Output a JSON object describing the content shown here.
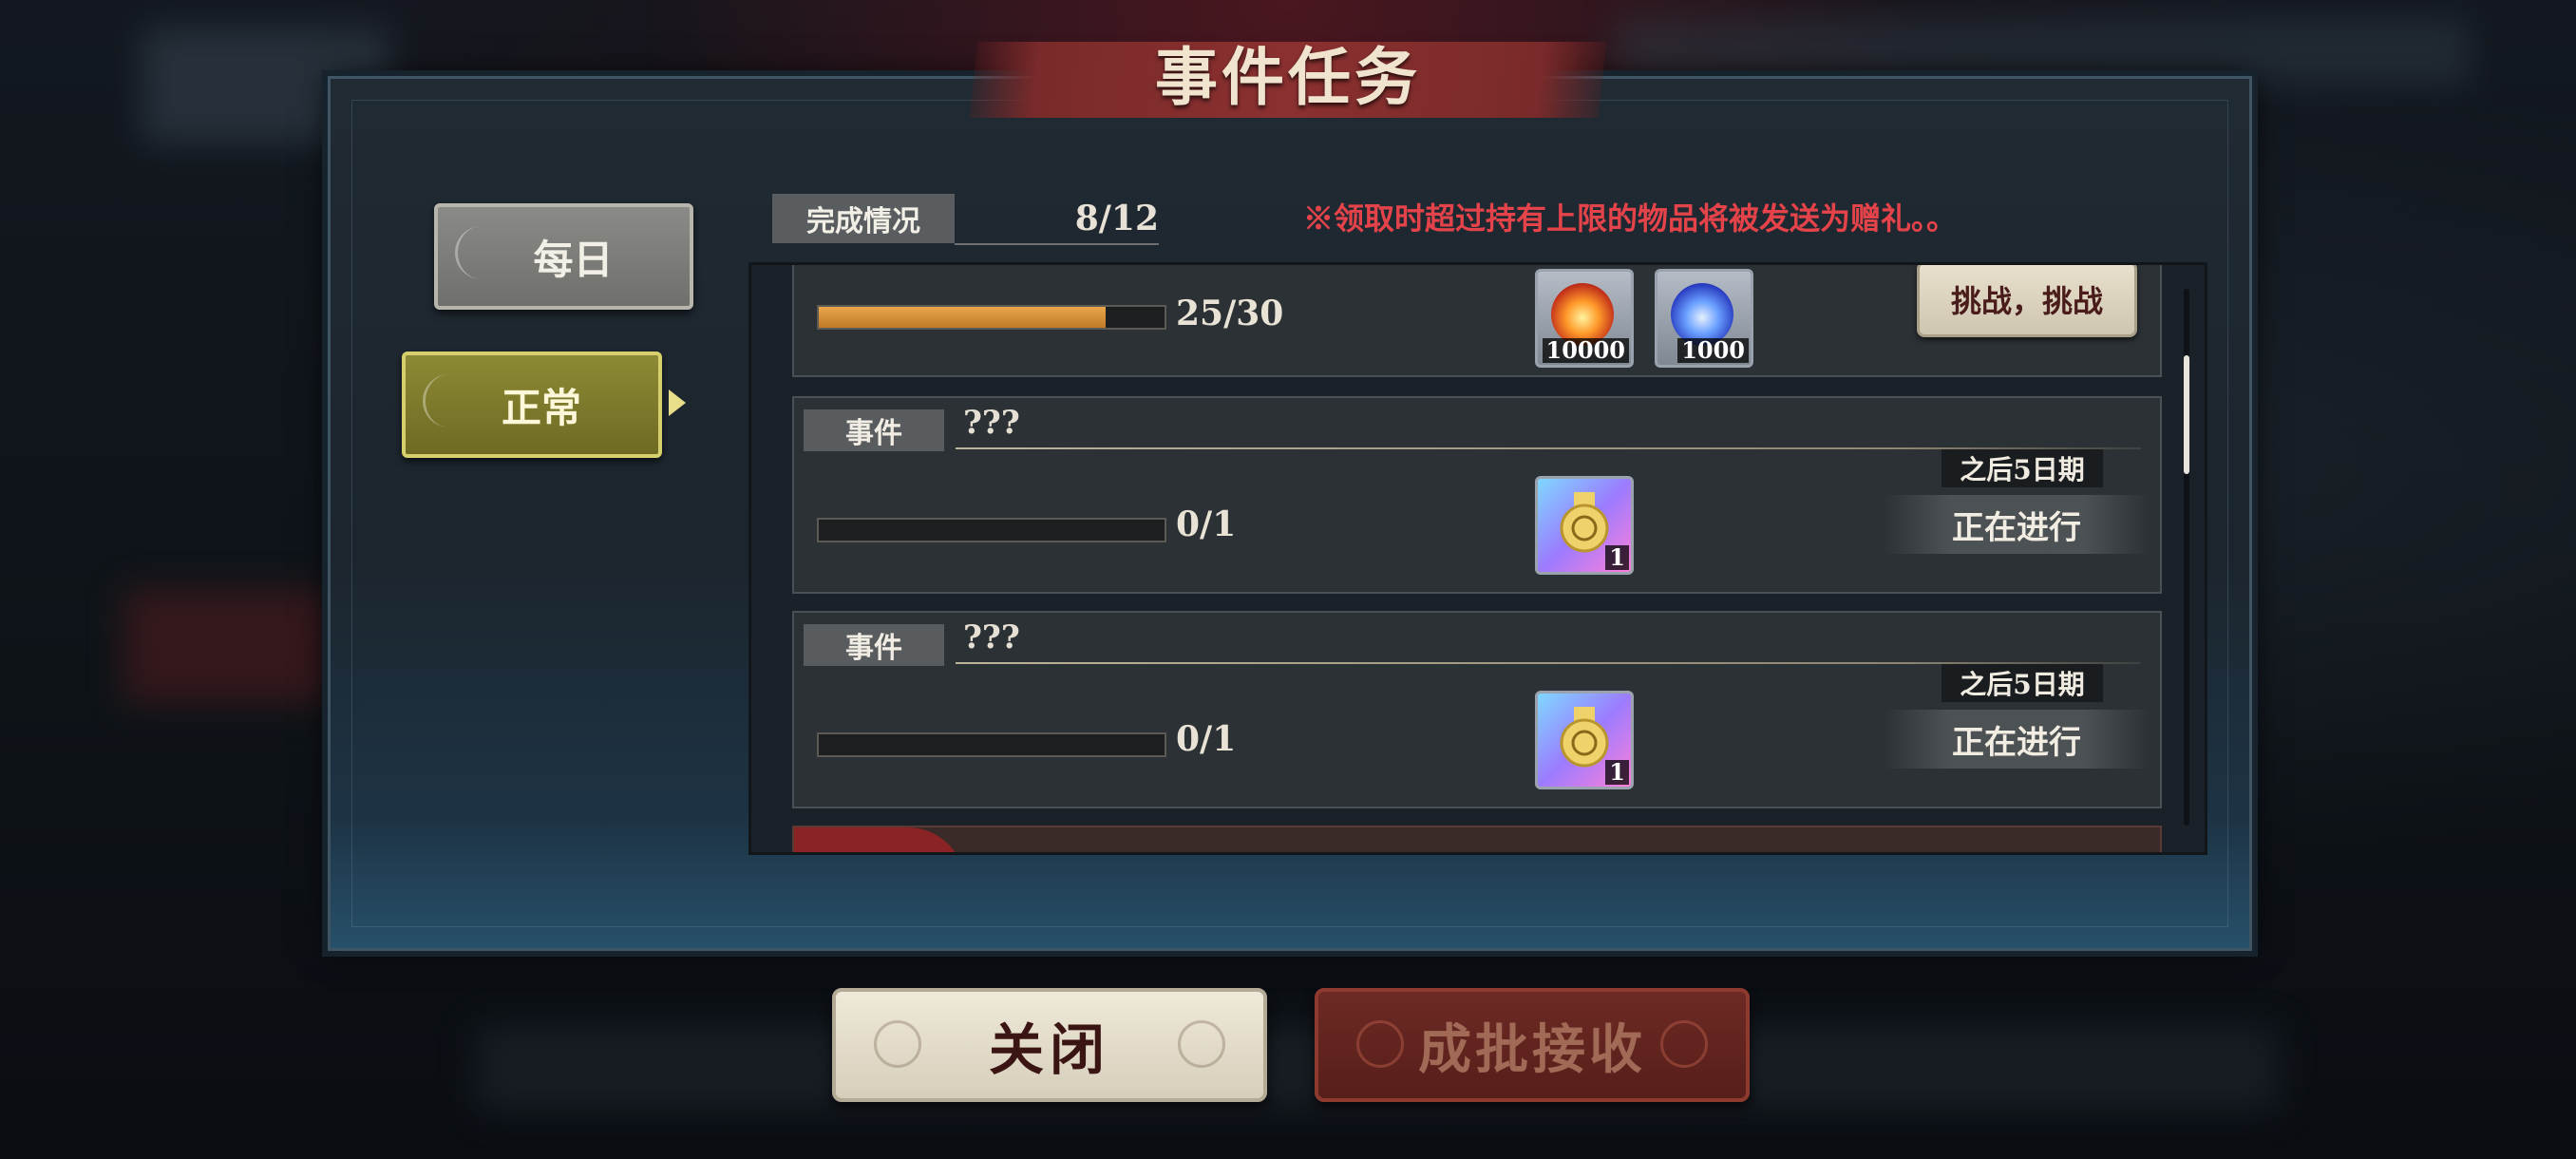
{
  "title": "事件任务",
  "tabs": [
    {
      "label": "每日",
      "selected": false
    },
    {
      "label": "正常",
      "selected": true
    }
  ],
  "completion": {
    "label": "完成情况",
    "value": "8/12"
  },
  "notice": "※领取时超过持有上限的物品将被发送为赠礼。。",
  "tasks": [
    {
      "progress_text": "25/30",
      "progress_fraction": 0.83,
      "rewards": [
        {
          "icon": "fire-orb-icon",
          "count": "10000"
        },
        {
          "icon": "blue-orb-icon",
          "count": "1000"
        }
      ],
      "action": "挑战，挑战"
    },
    {
      "tag": "事件",
      "name": "???",
      "progress_text": "0/1",
      "progress_fraction": 0,
      "rewards": [
        {
          "icon": "medal-icon",
          "count": "1"
        }
      ],
      "expire": "之后5日期",
      "status": "正在进行"
    },
    {
      "tag": "事件",
      "name": "???",
      "progress_text": "0/1",
      "progress_fraction": 0,
      "rewards": [
        {
          "icon": "medal-icon",
          "count": "1"
        }
      ],
      "expire": "之后5日期",
      "status": "正在进行"
    }
  ],
  "buttons": {
    "close": "关闭",
    "batch_receive": "成批接收"
  },
  "colors": {
    "notice": "#e5434a",
    "progress": "#d8903a",
    "selected_tab": "#7d7a2c"
  }
}
